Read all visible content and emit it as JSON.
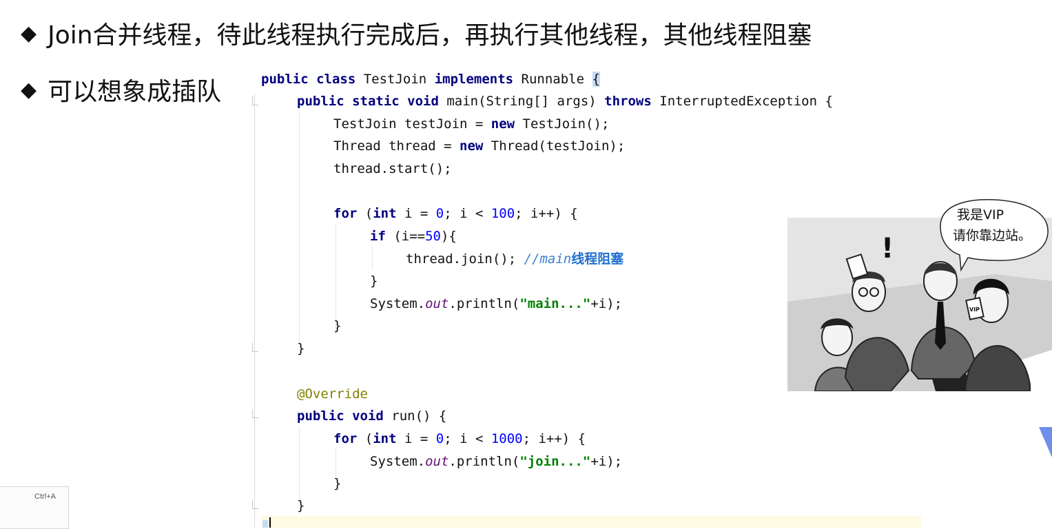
{
  "slide": {
    "bullet1": "Join合并线程，待此线程执行完成后，再执行其他线程，其他线程阻塞",
    "bullet2": "可以想象成插队"
  },
  "code": {
    "l1": {
      "kw1": "public class",
      "name": "TestJoin",
      "kw2": "implements",
      "rest": "Runnable",
      "brace": "{"
    },
    "l2": {
      "kw1": "public static void",
      "name": "main(String[] args)",
      "kw2": "throws",
      "rest": "InterruptedException {"
    },
    "l3": {
      "a": "TestJoin testJoin = ",
      "kw": "new",
      "b": " TestJoin();"
    },
    "l4": {
      "a": "Thread thread = ",
      "kw": "new",
      "b": " Thread(testJoin);"
    },
    "l5": "thread.start();",
    "l6": {
      "kw1": "for",
      "a": " (",
      "kw2": "int",
      "b": " i = ",
      "n1": "0",
      "c": "; i < ",
      "n2": "100",
      "d": "; i++) {"
    },
    "l7": {
      "kw": "if",
      "a": " (i==",
      "n": "50",
      "b": "){"
    },
    "l8": {
      "a": "thread.join(); ",
      "comment": "//main",
      "comment_cn": "线程阻塞"
    },
    "l9": "}",
    "l10": {
      "a": "System.",
      "ital": "out",
      "b": ".println(",
      "str": "\"main...\"",
      "c": "+i);"
    },
    "l11": "}",
    "l12": "}",
    "l13": "@Override",
    "l14": {
      "kw": "public void",
      "a": " run() {"
    },
    "l15": {
      "kw1": "for",
      "a": " (",
      "kw2": "int",
      "b": " i = ",
      "n1": "0",
      "c": "; i < ",
      "n2": "1000",
      "d": "; i++) {"
    },
    "l16": {
      "a": "System.",
      "ital": "out",
      "b": ".println(",
      "str": "\"join...\"",
      "c": "+i);"
    },
    "l17": "}",
    "l18": "}"
  },
  "cartoon": {
    "bubble_line1": "我是VIP",
    "bubble_line2": "请你靠边站。",
    "exclaim": "!",
    "card": "VIP"
  },
  "shortcut": {
    "label": "Ctrl+A"
  },
  "colors": {
    "keyword": "#000080",
    "number": "#0000ff",
    "string": "#008000",
    "comment": "#3a7dd4",
    "annotation": "#808000"
  }
}
